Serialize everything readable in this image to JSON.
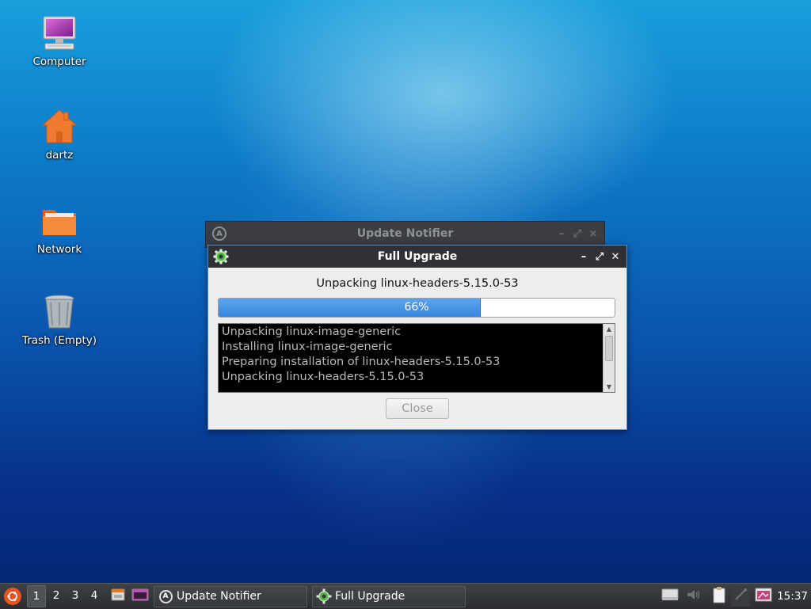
{
  "desktop": {
    "icons": [
      {
        "label": "Computer",
        "icon": "computer-icon"
      },
      {
        "label": "dartz",
        "icon": "home-folder-icon"
      },
      {
        "label": "Network",
        "icon": "network-folder-icon"
      },
      {
        "label": "Trash (Empty)",
        "icon": "trash-icon"
      }
    ]
  },
  "notifier_window": {
    "title": "Update Notifier",
    "icon": "update-notifier-icon",
    "buttons": {
      "minimize": "–",
      "maximize": "⤢",
      "close": "×"
    }
  },
  "upgrade_window": {
    "title": "Full Upgrade",
    "icon": "gear-icon",
    "buttons": {
      "minimize": "–",
      "maximize": "⤢",
      "close": "✕"
    },
    "status": "Unpacking linux-headers-5.15.0-53",
    "progress": {
      "percent": 66,
      "label": "66%"
    },
    "log_lines": [
      "Unpacking linux-image-generic",
      "Installing linux-image-generic",
      "Preparing installation of linux-headers-5.15.0-53",
      "Unpacking linux-headers-5.15.0-53"
    ],
    "close_label": "Close"
  },
  "taskbar": {
    "menu_icon": "start-menu-icon",
    "workspaces": [
      "1",
      "2",
      "3",
      "4"
    ],
    "active_workspace": "1",
    "launchers": [
      "file-manager-icon",
      "terminal-icon"
    ],
    "tasks": [
      {
        "label": "Update Notifier",
        "icon": "update-notifier-icon"
      },
      {
        "label": "Full Upgrade",
        "icon": "gear-icon"
      }
    ],
    "tray": [
      "removable-drive-icon",
      "volume-icon",
      "clipboard-icon",
      "network-icon",
      "screenshot-icon"
    ],
    "clock": "15:37"
  },
  "colors": {
    "accent": "#3b86dc",
    "titlebar": "#2f3135",
    "taskbar": "#2b2d30"
  }
}
